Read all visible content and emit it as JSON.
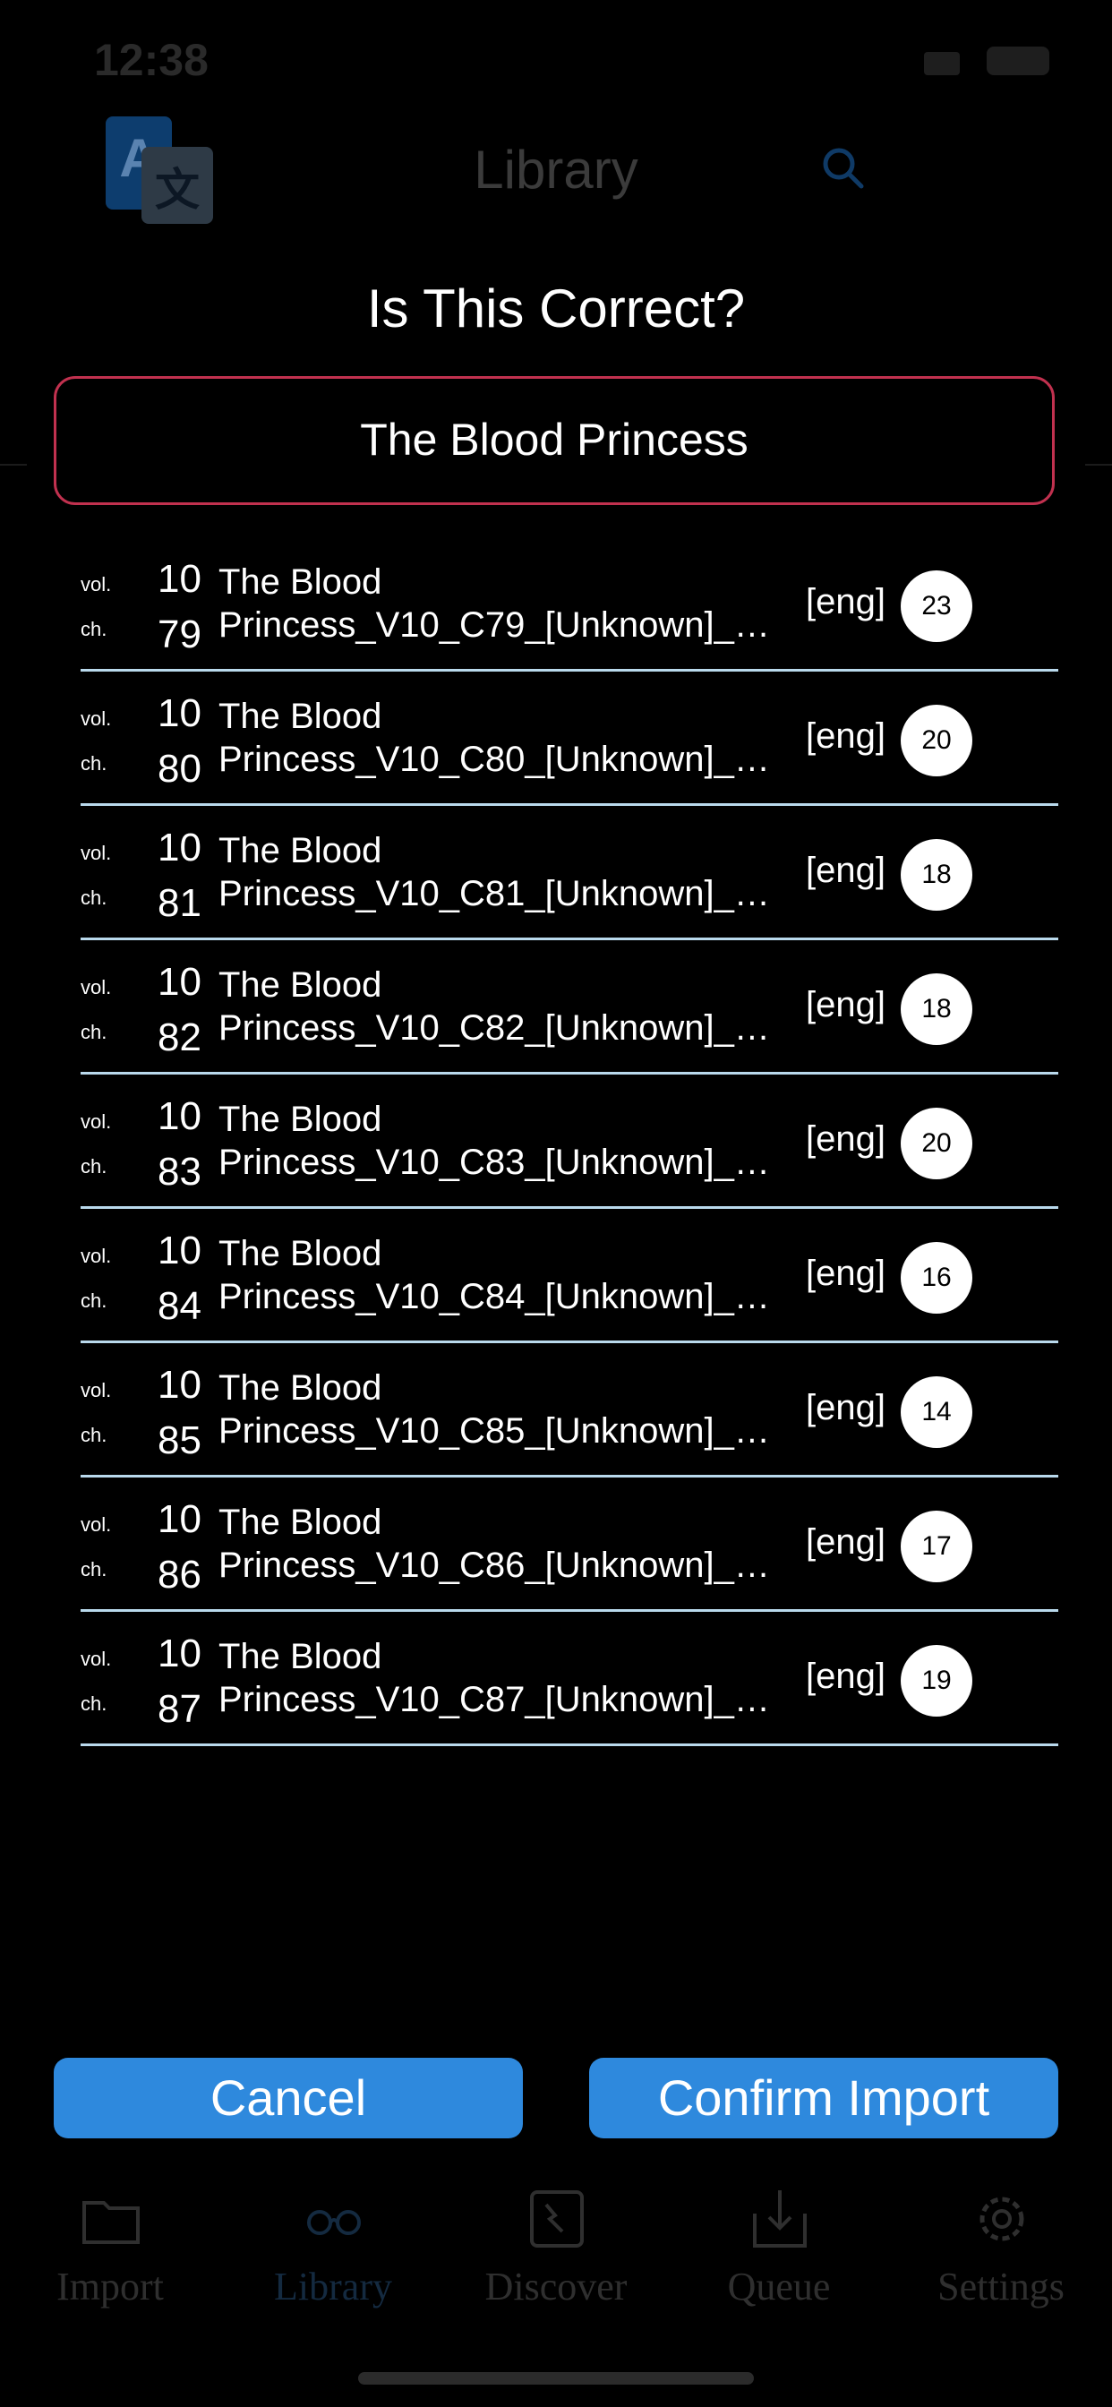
{
  "status_bar": {
    "time": "12:38"
  },
  "nav": {
    "title": "Library"
  },
  "modal": {
    "title": "Is This Correct?",
    "series_title": "The Blood Princess",
    "chapters": [
      {
        "vol_label": "vol.",
        "vol": "10",
        "ch_label": "ch.",
        "ch": "79",
        "name_line1": "The Blood",
        "name_line2": "Princess_V10_C79_[Unknown]_l…",
        "lang": "[eng]",
        "pages": "23"
      },
      {
        "vol_label": "vol.",
        "vol": "10",
        "ch_label": "ch.",
        "ch": "80",
        "name_line1": "The Blood",
        "name_line2": "Princess_V10_C80_[Unknown]_l…",
        "lang": "[eng]",
        "pages": "20"
      },
      {
        "vol_label": "vol.",
        "vol": "10",
        "ch_label": "ch.",
        "ch": "81",
        "name_line1": "The Blood",
        "name_line2": "Princess_V10_C81_[Unknown]_l…",
        "lang": "[eng]",
        "pages": "18"
      },
      {
        "vol_label": "vol.",
        "vol": "10",
        "ch_label": "ch.",
        "ch": "82",
        "name_line1": "The Blood",
        "name_line2": "Princess_V10_C82_[Unknown]_l…",
        "lang": "[eng]",
        "pages": "18"
      },
      {
        "vol_label": "vol.",
        "vol": "10",
        "ch_label": "ch.",
        "ch": "83",
        "name_line1": "The Blood",
        "name_line2": "Princess_V10_C83_[Unknown]_l…",
        "lang": "[eng]",
        "pages": "20"
      },
      {
        "vol_label": "vol.",
        "vol": "10",
        "ch_label": "ch.",
        "ch": "84",
        "name_line1": "The Blood",
        "name_line2": "Princess_V10_C84_[Unknown]_l…",
        "lang": "[eng]",
        "pages": "16"
      },
      {
        "vol_label": "vol.",
        "vol": "10",
        "ch_label": "ch.",
        "ch": "85",
        "name_line1": "The Blood",
        "name_line2": "Princess_V10_C85_[Unknown]_l…",
        "lang": "[eng]",
        "pages": "14"
      },
      {
        "vol_label": "vol.",
        "vol": "10",
        "ch_label": "ch.",
        "ch": "86",
        "name_line1": "The Blood",
        "name_line2": "Princess_V10_C86_[Unknown]_l…",
        "lang": "[eng]",
        "pages": "17"
      },
      {
        "vol_label": "vol.",
        "vol": "10",
        "ch_label": "ch.",
        "ch": "87",
        "name_line1": "The Blood",
        "name_line2": "Princess_V10_C87_[Unknown]_l…",
        "lang": "[eng]",
        "pages": "19"
      }
    ],
    "cancel_label": "Cancel",
    "confirm_label": "Confirm Import"
  },
  "tab_bar": {
    "tabs": [
      {
        "label": "Import",
        "icon": "folder-icon"
      },
      {
        "label": "Library",
        "icon": "glasses-icon",
        "active": true
      },
      {
        "label": "Discover",
        "icon": "discover-icon"
      },
      {
        "label": "Queue",
        "icon": "download-tray-icon"
      },
      {
        "label": "Settings",
        "icon": "gear-icon"
      }
    ]
  },
  "colors": {
    "accent": "#2e89dd",
    "title_border": "#c1314f",
    "row_divider": "#b9d9ec"
  }
}
